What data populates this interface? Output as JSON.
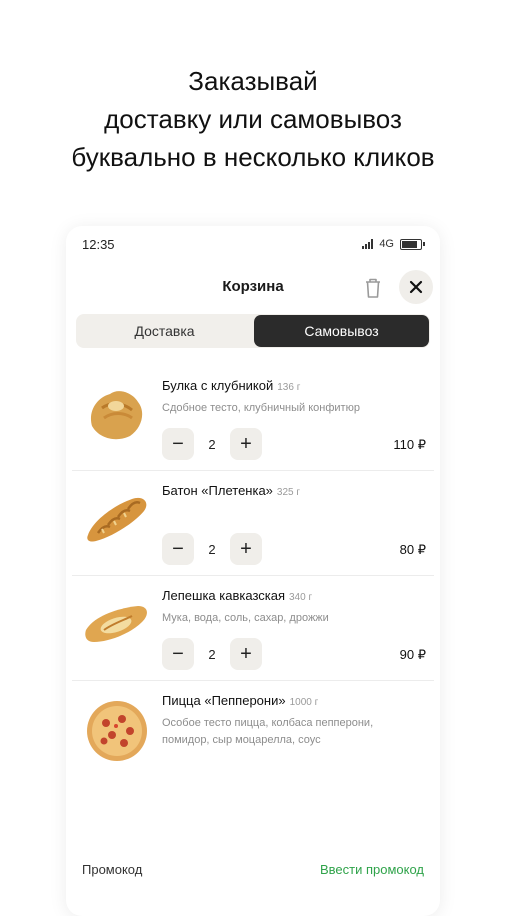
{
  "headline": {
    "line1": "Заказывай",
    "line2": "доставку или самовывоз",
    "line3": "буквально в несколько кликов"
  },
  "status_bar": {
    "time": "12:35",
    "network": "4G"
  },
  "header": {
    "title": "Корзина"
  },
  "tabs": [
    {
      "label": "Доставка",
      "active": false
    },
    {
      "label": "Самовывоз",
      "active": true
    }
  ],
  "items": [
    {
      "name": "Булка с клубникой",
      "weight": "136 г",
      "desc": "Сдобное тесто, клубничный конфитюр",
      "qty": "2",
      "price": "110 ₽",
      "icon": "pastry-bun-image"
    },
    {
      "name": "Батон «Плетенка»",
      "weight": "325 г",
      "desc": "",
      "qty": "2",
      "price": "80 ₽",
      "icon": "braided-bread-image"
    },
    {
      "name": "Лепешка кавказская",
      "weight": "340 г",
      "desc": "Мука, вода, соль, сахар, дрожжи",
      "qty": "2",
      "price": "90 ₽",
      "icon": "flatbread-image"
    },
    {
      "name": "Пицца «Пепперони»",
      "weight": "1000 г",
      "desc": "Особое тесто пицца, колбаса пепперони, помидор, сыр моцарелла, соус",
      "qty": "",
      "price": "",
      "icon": "pepperoni-pizza-image"
    }
  ],
  "promo": {
    "label": "Промокод",
    "link": "Ввести промокод"
  },
  "colors": {
    "accent_green": "#2fa34a",
    "active_tab": "#2b2b2b",
    "chip_bg": "#f0eeea"
  }
}
